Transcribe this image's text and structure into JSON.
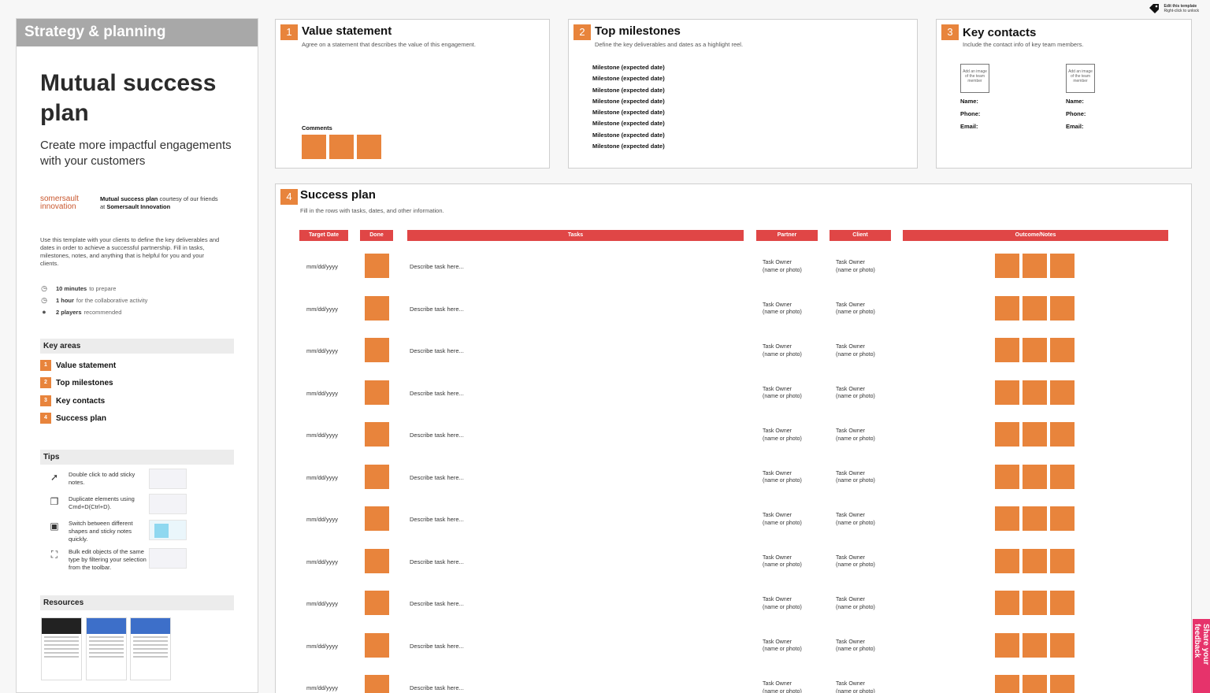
{
  "top_right": {
    "edit_title": "Edit this template",
    "edit_sub": "Right-click to unlock",
    "icon": "tag-icon"
  },
  "left_panel": {
    "header": "Strategy & planning",
    "title": "Mutual success plan",
    "subtitle": "Create more impactful engagements with your customers",
    "brand_logo": "somersault innovation",
    "brand_text_1": "Mutual success plan",
    "brand_text_2": " courtesy of our friends at ",
    "brand_text_3": "Somersault Innovation",
    "description": "Use this template with your clients to define the key deliverables and dates in order to achieve a successful partnership. Fill in tasks, milestones, notes, and anything that is helpful for you and your clients.",
    "meta": [
      {
        "bold": "10 minutes",
        "rest": "to prepare",
        "icon": "clock-icon"
      },
      {
        "bold": "1 hour",
        "rest": "for the collaborative activity",
        "icon": "clock-icon"
      },
      {
        "bold": "2 players",
        "rest": "recommended",
        "icon": "person-icon"
      }
    ],
    "key_areas_title": "Key areas",
    "key_areas": [
      {
        "num": "1",
        "label": "Value statement"
      },
      {
        "num": "2",
        "label": "Top milestones"
      },
      {
        "num": "3",
        "label": "Key contacts"
      },
      {
        "num": "4",
        "label": "Success plan"
      }
    ],
    "tips_title": "Tips",
    "tips": [
      {
        "text": "Double click to add sticky notes.",
        "icon": "cursor-click-icon"
      },
      {
        "text": "Duplicate elements using Cmd+D(Ctrl+D).",
        "icon": "duplicate-icon"
      },
      {
        "text": "Switch between different shapes and sticky notes quickly.",
        "icon": "shapes-icon"
      },
      {
        "text": "Bulk edit objects of the same type by filtering your selection from the toolbar.",
        "icon": "select-filter-icon"
      }
    ],
    "resources_title": "Resources"
  },
  "value_statement": {
    "num": "1",
    "title": "Value statement",
    "subtitle": "Agree on a statement that describes the value of this engagement.",
    "comments_label": "Comments"
  },
  "top_milestones": {
    "num": "2",
    "title": "Top milestones",
    "subtitle": "Define the key deliverables and dates as a highlight reel.",
    "items": [
      "Milestone (expected date)",
      "Milestone (expected date)",
      "Milestone (expected date)",
      "Milestone (expected date)",
      "Milestone (expected date)",
      "Milestone (expected date)",
      "Milestone (expected date)",
      "Milestone (expected date)"
    ]
  },
  "key_contacts": {
    "num": "3",
    "title": "Key contacts",
    "subtitle": "Include the contact info of key team members.",
    "image_placeholder": "Add an image of the team member",
    "name_label": "Name:",
    "phone_label": "Phone:",
    "email_label": "Email:"
  },
  "success_plan": {
    "num": "4",
    "title": "Success plan",
    "subtitle": "Fill in the rows with tasks, dates, and other information.",
    "headers": {
      "target_date": "Target Date",
      "done": "Done",
      "tasks": "Tasks",
      "partner": "Partner",
      "client": "Client",
      "outcome": "Outcome/Notes"
    },
    "rows": [
      {
        "date": "mm/dd/yyyy",
        "task": "Describe task here...",
        "owner_1": "Task Owner",
        "owner_2": "(name or photo)"
      },
      {
        "date": "mm/dd/yyyy",
        "task": "Describe task here...",
        "owner_1": "Task Owner",
        "owner_2": "(name or photo)"
      },
      {
        "date": "mm/dd/yyyy",
        "task": "Describe task here...",
        "owner_1": "Task Owner",
        "owner_2": "(name or photo)"
      },
      {
        "date": "mm/dd/yyyy",
        "task": "Describe task here...",
        "owner_1": "Task Owner",
        "owner_2": "(name or photo)"
      },
      {
        "date": "mm/dd/yyyy",
        "task": "Describe task here...",
        "owner_1": "Task Owner",
        "owner_2": "(name or photo)"
      },
      {
        "date": "mm/dd/yyyy",
        "task": "Describe task here...",
        "owner_1": "Task Owner",
        "owner_2": "(name or photo)"
      },
      {
        "date": "mm/dd/yyyy",
        "task": "Describe task here...",
        "owner_1": "Task Owner",
        "owner_2": "(name or photo)"
      },
      {
        "date": "mm/dd/yyyy",
        "task": "Describe task here...",
        "owner_1": "Task Owner",
        "owner_2": "(name or photo)"
      },
      {
        "date": "mm/dd/yyyy",
        "task": "Describe task here...",
        "owner_1": "Task Owner",
        "owner_2": "(name or photo)"
      },
      {
        "date": "mm/dd/yyyy",
        "task": "Describe task here...",
        "owner_1": "Task Owner",
        "owner_2": "(name or photo)"
      },
      {
        "date": "mm/dd/yyyy",
        "task": "Describe task here...",
        "owner_1": "Task Owner",
        "owner_2": "(name or photo)"
      }
    ]
  },
  "share_tab": "Share your feedback",
  "colors": {
    "accent": "#e8843c",
    "header_red": "#e04646",
    "share_pink": "#e6336b",
    "panel_header": "#a8a8a8"
  }
}
